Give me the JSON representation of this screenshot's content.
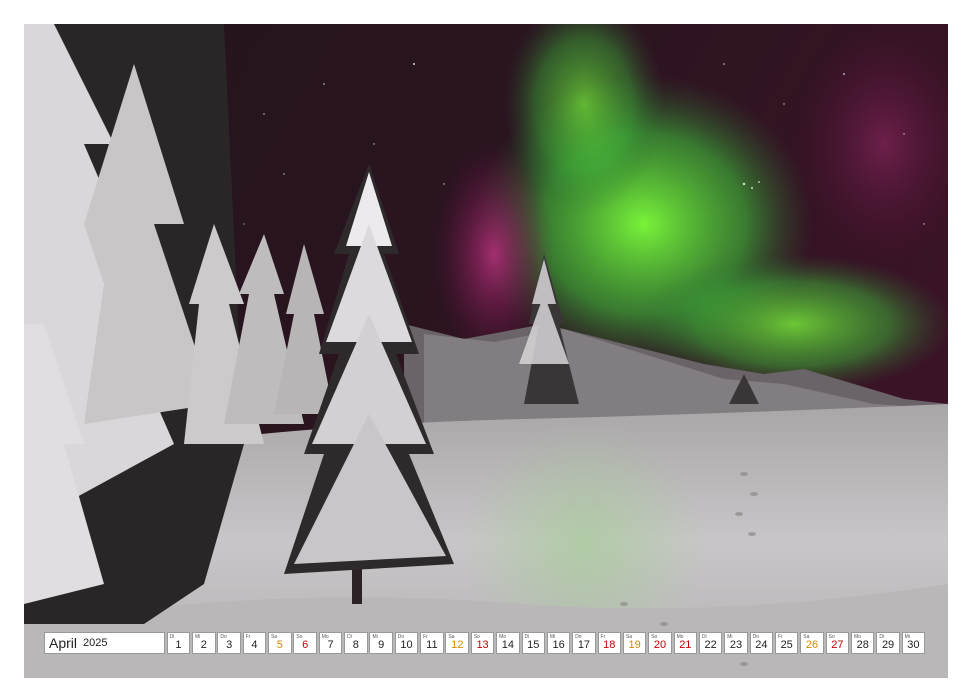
{
  "calendar": {
    "month": "April",
    "year": "2025",
    "days": [
      {
        "dow": "Di",
        "num": "1",
        "kind": "work"
      },
      {
        "dow": "Mi",
        "num": "2",
        "kind": "work"
      },
      {
        "dow": "Do",
        "num": "3",
        "kind": "work"
      },
      {
        "dow": "Fr",
        "num": "4",
        "kind": "work"
      },
      {
        "dow": "Sa",
        "num": "5",
        "kind": "sat"
      },
      {
        "dow": "So",
        "num": "6",
        "kind": "sun"
      },
      {
        "dow": "Mo",
        "num": "7",
        "kind": "work"
      },
      {
        "dow": "Di",
        "num": "8",
        "kind": "work"
      },
      {
        "dow": "Mi",
        "num": "9",
        "kind": "work"
      },
      {
        "dow": "Do",
        "num": "10",
        "kind": "work"
      },
      {
        "dow": "Fr",
        "num": "11",
        "kind": "work"
      },
      {
        "dow": "Sa",
        "num": "12",
        "kind": "sat"
      },
      {
        "dow": "So",
        "num": "13",
        "kind": "sun"
      },
      {
        "dow": "Mo",
        "num": "14",
        "kind": "work"
      },
      {
        "dow": "Di",
        "num": "15",
        "kind": "work"
      },
      {
        "dow": "Mi",
        "num": "16",
        "kind": "work"
      },
      {
        "dow": "Do",
        "num": "17",
        "kind": "work"
      },
      {
        "dow": "Fr",
        "num": "18",
        "kind": "hol"
      },
      {
        "dow": "Sa",
        "num": "19",
        "kind": "sat"
      },
      {
        "dow": "So",
        "num": "20",
        "kind": "sun"
      },
      {
        "dow": "Mo",
        "num": "21",
        "kind": "hol"
      },
      {
        "dow": "Di",
        "num": "22",
        "kind": "work"
      },
      {
        "dow": "Mi",
        "num": "23",
        "kind": "work"
      },
      {
        "dow": "Do",
        "num": "24",
        "kind": "work"
      },
      {
        "dow": "Fr",
        "num": "25",
        "kind": "work"
      },
      {
        "dow": "Sa",
        "num": "26",
        "kind": "sat"
      },
      {
        "dow": "So",
        "num": "27",
        "kind": "sun"
      },
      {
        "dow": "Mo",
        "num": "28",
        "kind": "work"
      },
      {
        "dow": "Di",
        "num": "29",
        "kind": "work"
      },
      {
        "dow": "Mi",
        "num": "30",
        "kind": "work"
      }
    ]
  },
  "colors": {
    "saturday": "#d58a00",
    "sunday_holiday": "#c00000",
    "aurora_green": "#5fd03a",
    "aurora_magenta": "#9a2a6a"
  }
}
